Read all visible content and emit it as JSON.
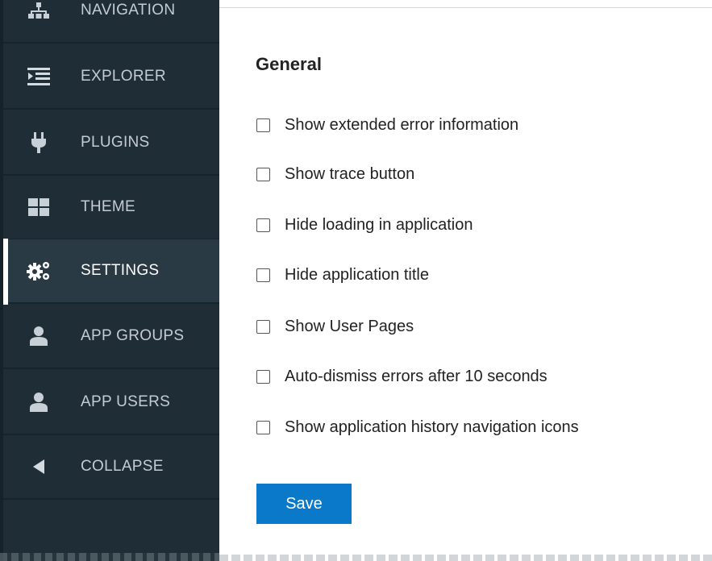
{
  "sidebar": {
    "items": [
      {
        "label": "NAVIGATION",
        "icon": "navigation-icon"
      },
      {
        "label": "EXPLORER",
        "icon": "explorer-icon"
      },
      {
        "label": "PLUGINS",
        "icon": "plug-icon"
      },
      {
        "label": "THEME",
        "icon": "theme-grid-icon"
      },
      {
        "label": "SETTINGS",
        "icon": "gears-icon",
        "active": true
      },
      {
        "label": "APP GROUPS",
        "icon": "user-icon"
      },
      {
        "label": "APP USERS",
        "icon": "user-icon"
      },
      {
        "label": "COLLAPSE",
        "icon": "triangle-left-icon"
      }
    ]
  },
  "main": {
    "title": "General",
    "options": [
      {
        "label": "Show extended error information",
        "checked": false
      },
      {
        "label": "Show trace button",
        "checked": false
      },
      {
        "label": "Hide loading in application",
        "checked": false
      },
      {
        "label": "Hide application title",
        "checked": false
      },
      {
        "label": "Show User Pages",
        "checked": false
      },
      {
        "label": "Auto-dismiss errors after 10 seconds",
        "checked": false
      },
      {
        "label": "Show application history navigation icons",
        "checked": false
      }
    ],
    "save_label": "Save"
  },
  "colors": {
    "sidebar_bg": "#1f2d36",
    "sidebar_active_bg": "#2a3a44",
    "accent_button": "#0b79c9"
  }
}
